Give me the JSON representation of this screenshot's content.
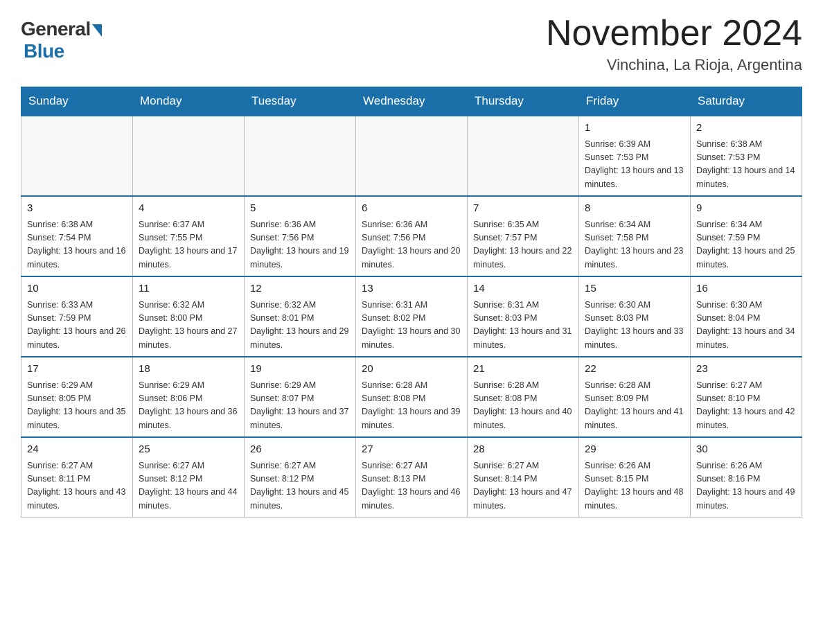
{
  "logo": {
    "general": "General",
    "blue": "Blue"
  },
  "title": "November 2024",
  "subtitle": "Vinchina, La Rioja, Argentina",
  "days_of_week": [
    "Sunday",
    "Monday",
    "Tuesday",
    "Wednesday",
    "Thursday",
    "Friday",
    "Saturday"
  ],
  "weeks": [
    [
      {
        "day": "",
        "info": ""
      },
      {
        "day": "",
        "info": ""
      },
      {
        "day": "",
        "info": ""
      },
      {
        "day": "",
        "info": ""
      },
      {
        "day": "",
        "info": ""
      },
      {
        "day": "1",
        "info": "Sunrise: 6:39 AM\nSunset: 7:53 PM\nDaylight: 13 hours and 13 minutes."
      },
      {
        "day": "2",
        "info": "Sunrise: 6:38 AM\nSunset: 7:53 PM\nDaylight: 13 hours and 14 minutes."
      }
    ],
    [
      {
        "day": "3",
        "info": "Sunrise: 6:38 AM\nSunset: 7:54 PM\nDaylight: 13 hours and 16 minutes."
      },
      {
        "day": "4",
        "info": "Sunrise: 6:37 AM\nSunset: 7:55 PM\nDaylight: 13 hours and 17 minutes."
      },
      {
        "day": "5",
        "info": "Sunrise: 6:36 AM\nSunset: 7:56 PM\nDaylight: 13 hours and 19 minutes."
      },
      {
        "day": "6",
        "info": "Sunrise: 6:36 AM\nSunset: 7:56 PM\nDaylight: 13 hours and 20 minutes."
      },
      {
        "day": "7",
        "info": "Sunrise: 6:35 AM\nSunset: 7:57 PM\nDaylight: 13 hours and 22 minutes."
      },
      {
        "day": "8",
        "info": "Sunrise: 6:34 AM\nSunset: 7:58 PM\nDaylight: 13 hours and 23 minutes."
      },
      {
        "day": "9",
        "info": "Sunrise: 6:34 AM\nSunset: 7:59 PM\nDaylight: 13 hours and 25 minutes."
      }
    ],
    [
      {
        "day": "10",
        "info": "Sunrise: 6:33 AM\nSunset: 7:59 PM\nDaylight: 13 hours and 26 minutes."
      },
      {
        "day": "11",
        "info": "Sunrise: 6:32 AM\nSunset: 8:00 PM\nDaylight: 13 hours and 27 minutes."
      },
      {
        "day": "12",
        "info": "Sunrise: 6:32 AM\nSunset: 8:01 PM\nDaylight: 13 hours and 29 minutes."
      },
      {
        "day": "13",
        "info": "Sunrise: 6:31 AM\nSunset: 8:02 PM\nDaylight: 13 hours and 30 minutes."
      },
      {
        "day": "14",
        "info": "Sunrise: 6:31 AM\nSunset: 8:03 PM\nDaylight: 13 hours and 31 minutes."
      },
      {
        "day": "15",
        "info": "Sunrise: 6:30 AM\nSunset: 8:03 PM\nDaylight: 13 hours and 33 minutes."
      },
      {
        "day": "16",
        "info": "Sunrise: 6:30 AM\nSunset: 8:04 PM\nDaylight: 13 hours and 34 minutes."
      }
    ],
    [
      {
        "day": "17",
        "info": "Sunrise: 6:29 AM\nSunset: 8:05 PM\nDaylight: 13 hours and 35 minutes."
      },
      {
        "day": "18",
        "info": "Sunrise: 6:29 AM\nSunset: 8:06 PM\nDaylight: 13 hours and 36 minutes."
      },
      {
        "day": "19",
        "info": "Sunrise: 6:29 AM\nSunset: 8:07 PM\nDaylight: 13 hours and 37 minutes."
      },
      {
        "day": "20",
        "info": "Sunrise: 6:28 AM\nSunset: 8:08 PM\nDaylight: 13 hours and 39 minutes."
      },
      {
        "day": "21",
        "info": "Sunrise: 6:28 AM\nSunset: 8:08 PM\nDaylight: 13 hours and 40 minutes."
      },
      {
        "day": "22",
        "info": "Sunrise: 6:28 AM\nSunset: 8:09 PM\nDaylight: 13 hours and 41 minutes."
      },
      {
        "day": "23",
        "info": "Sunrise: 6:27 AM\nSunset: 8:10 PM\nDaylight: 13 hours and 42 minutes."
      }
    ],
    [
      {
        "day": "24",
        "info": "Sunrise: 6:27 AM\nSunset: 8:11 PM\nDaylight: 13 hours and 43 minutes."
      },
      {
        "day": "25",
        "info": "Sunrise: 6:27 AM\nSunset: 8:12 PM\nDaylight: 13 hours and 44 minutes."
      },
      {
        "day": "26",
        "info": "Sunrise: 6:27 AM\nSunset: 8:12 PM\nDaylight: 13 hours and 45 minutes."
      },
      {
        "day": "27",
        "info": "Sunrise: 6:27 AM\nSunset: 8:13 PM\nDaylight: 13 hours and 46 minutes."
      },
      {
        "day": "28",
        "info": "Sunrise: 6:27 AM\nSunset: 8:14 PM\nDaylight: 13 hours and 47 minutes."
      },
      {
        "day": "29",
        "info": "Sunrise: 6:26 AM\nSunset: 8:15 PM\nDaylight: 13 hours and 48 minutes."
      },
      {
        "day": "30",
        "info": "Sunrise: 6:26 AM\nSunset: 8:16 PM\nDaylight: 13 hours and 49 minutes."
      }
    ]
  ]
}
